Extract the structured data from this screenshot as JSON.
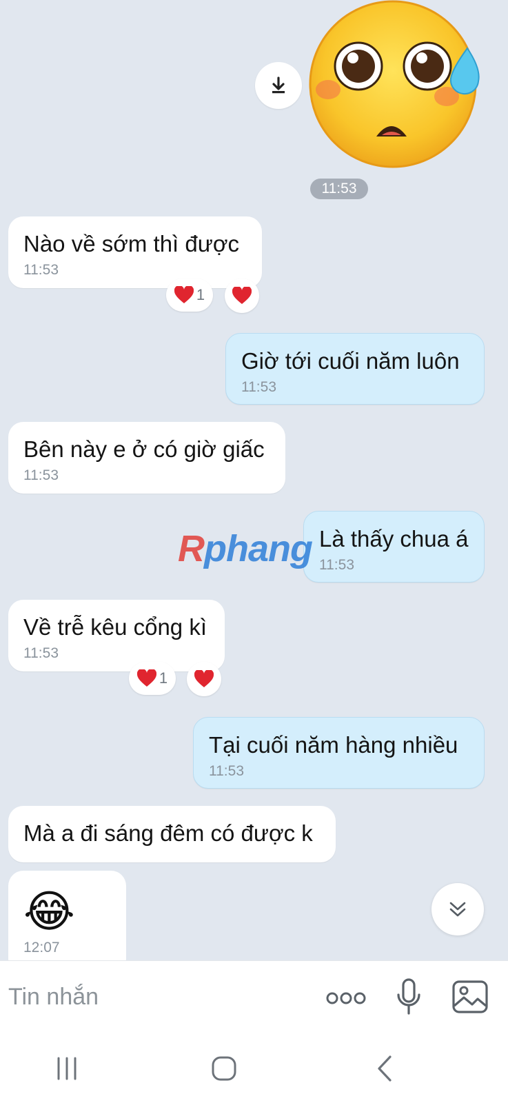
{
  "sticker": {
    "icon": "flushed-face-sticker"
  },
  "sticker_time": "11:53",
  "messages": [
    {
      "text": "Nào về sớm thì được",
      "time": "11:53",
      "direction": "in"
    },
    {
      "text": "Giờ tới cuối năm luôn",
      "time": "11:53",
      "direction": "out"
    },
    {
      "text": "Bên này e ở có giờ giấc",
      "time": "11:53",
      "direction": "in"
    },
    {
      "text": "Là thấy chua á",
      "time": "11:53",
      "direction": "out"
    },
    {
      "text": "Về trễ kêu cổng kì",
      "time": "11:53",
      "direction": "in"
    },
    {
      "text": "Tại cuối năm hàng nhiều",
      "time": "11:53",
      "direction": "out"
    },
    {
      "text": "Mà a đi sáng đêm có được k",
      "direction": "in"
    },
    {
      "emoji": "😂",
      "time": "12:07",
      "direction": "in"
    }
  ],
  "reactions": [
    {
      "icon": "heart-icon",
      "count": "1"
    },
    {
      "icon": "heart-icon"
    },
    {
      "icon": "heart-icon",
      "count": "1"
    },
    {
      "icon": "heart-icon"
    }
  ],
  "watermark": {
    "prefix": "R",
    "rest": "phang"
  },
  "composer": {
    "placeholder": "Tin nhắn"
  },
  "colors": {
    "outgoing_bubble": "#d4eefc",
    "incoming_bubble": "#ffffff",
    "chat_bg": "#e1e7ef",
    "heart": "#e0252f"
  }
}
